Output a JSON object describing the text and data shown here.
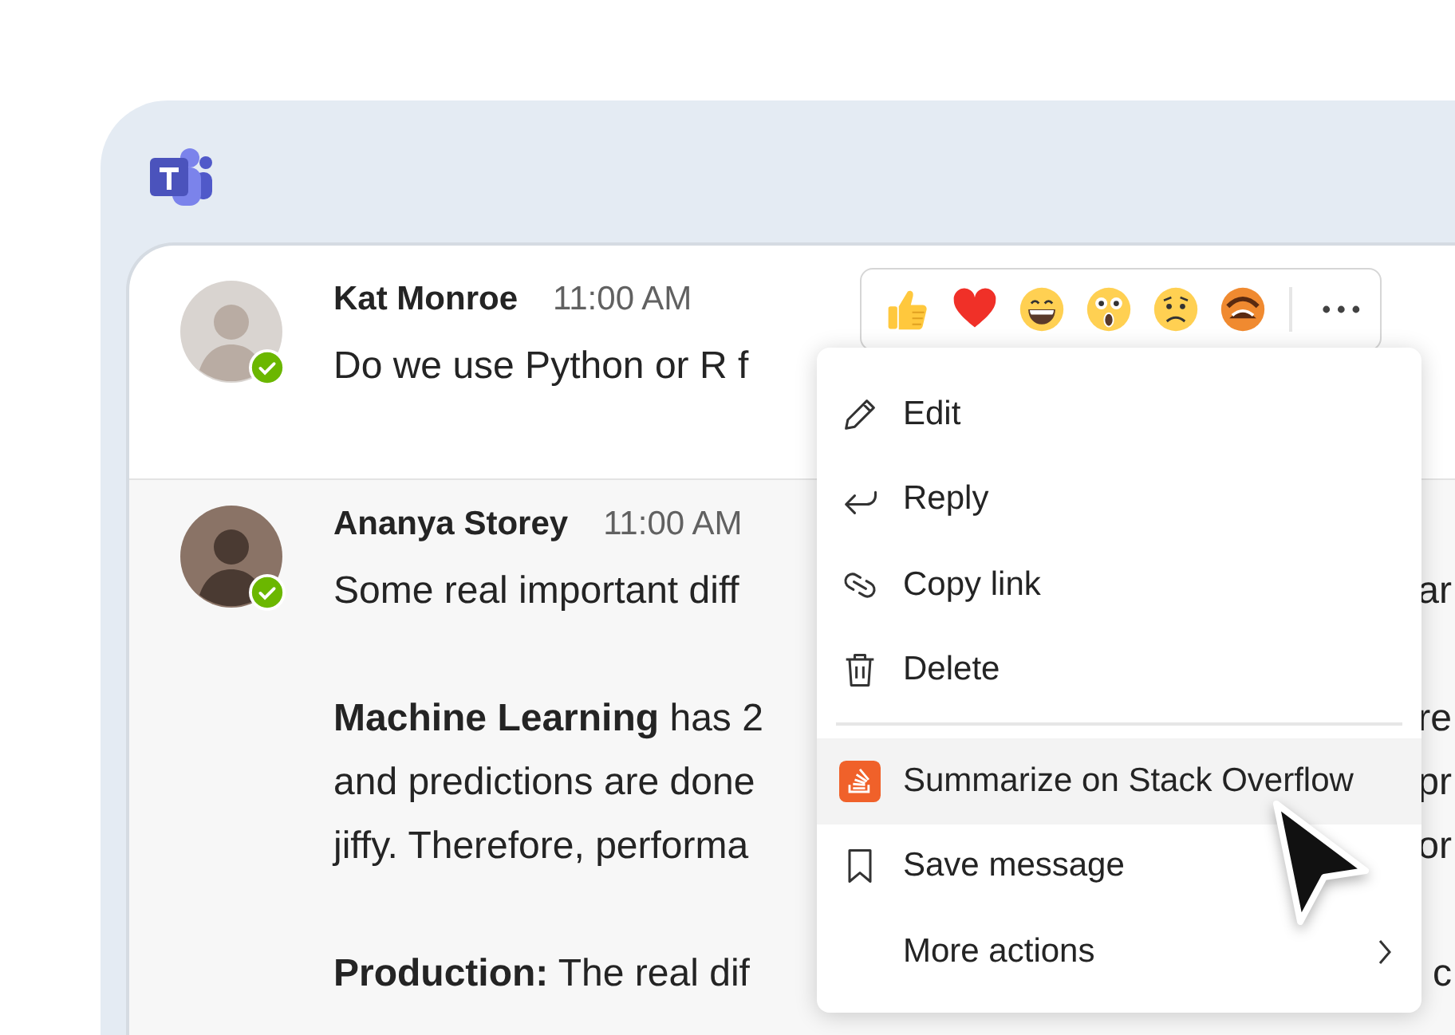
{
  "messages": [
    {
      "author": "Kat Monroe",
      "time": "11:00 AM",
      "paragraphs": [
        [
          {
            "left": "Do we use Python or R f"
          }
        ]
      ]
    },
    {
      "author": "Ananya Storey",
      "time": "11:00 AM",
      "paragraphs": [
        [
          {
            "left": "Some real important diff",
            "right": "ar"
          }
        ],
        [
          {
            "left": "**Machine Learning** has 2",
            "right": "re"
          },
          {
            "left": "and predictions are done",
            "right": "pr"
          },
          {
            "left": "jiffy. Therefore, performa",
            "right": "or"
          }
        ],
        [
          {
            "left": "**Production:** The real dif",
            "right": "c"
          }
        ]
      ]
    }
  ],
  "menu": {
    "groups": [
      [
        {
          "label": "Edit",
          "selected": false
        },
        {
          "label": "Reply",
          "selected": false
        },
        {
          "label": "Copy link",
          "selected": false
        },
        {
          "label": "Delete",
          "selected": false
        }
      ],
      [
        {
          "label": "Summarize on Stack Overflow",
          "selected": true
        },
        {
          "label": "Save message",
          "selected": false
        },
        {
          "label": "More actions",
          "selected": false,
          "submenu": true
        }
      ]
    ]
  }
}
